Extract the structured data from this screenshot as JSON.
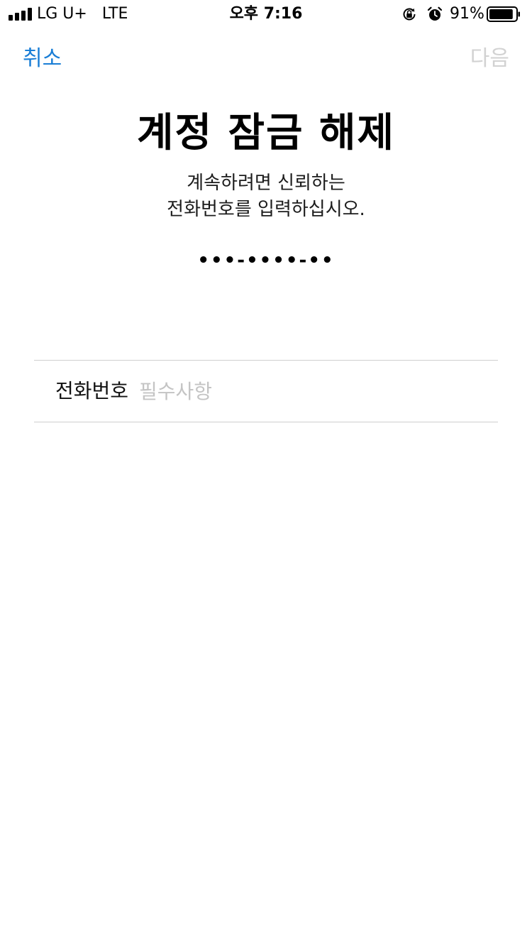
{
  "status_bar": {
    "carrier": "LG U+   LTE",
    "time": "오후 7:16",
    "battery_percent": "91%",
    "battery_level": 0.91,
    "signal_bars": 4,
    "icons": [
      "signal-icon",
      "lock-rotation-icon",
      "alarm-icon",
      "battery-icon"
    ]
  },
  "nav": {
    "cancel_label": "취소",
    "next_label": "다음",
    "accent_color": "#1a7ed6",
    "disabled_color": "#d2d2d2"
  },
  "main": {
    "title": "계정 잠금 해제",
    "description_lines": [
      "계속하려면 신뢰하는",
      "전화번호를 입력하십시오."
    ],
    "masked_phone": "•••-••••-••"
  },
  "form": {
    "phone_label": "전화번호",
    "phone_placeholder": "필수사항",
    "phone_value": ""
  }
}
